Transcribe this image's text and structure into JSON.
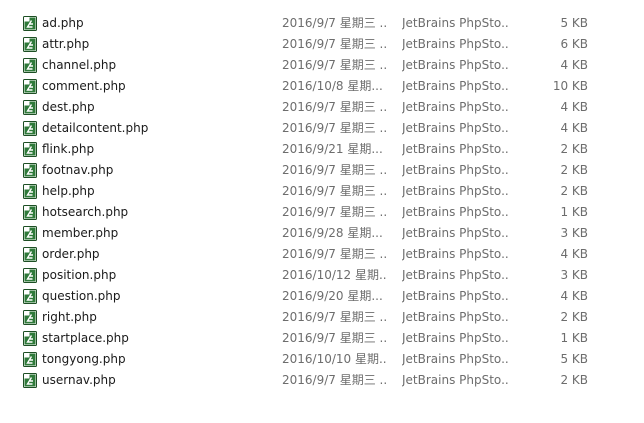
{
  "files": [
    {
      "name": "ad.php",
      "date": "2016/9/7 星期三 ...",
      "type": "JetBrains PhpSto...",
      "size": "5 KB",
      "icon": "php-file-icon"
    },
    {
      "name": "attr.php",
      "date": "2016/9/7 星期三 ...",
      "type": "JetBrains PhpSto...",
      "size": "6 KB",
      "icon": "php-file-icon"
    },
    {
      "name": "channel.php",
      "date": "2016/9/7 星期三 ...",
      "type": "JetBrains PhpSto...",
      "size": "4 KB",
      "icon": "php-file-icon"
    },
    {
      "name": "comment.php",
      "date": "2016/10/8 星期...",
      "type": "JetBrains PhpSto...",
      "size": "10 KB",
      "icon": "php-file-icon"
    },
    {
      "name": "dest.php",
      "date": "2016/9/7 星期三 ...",
      "type": "JetBrains PhpSto...",
      "size": "4 KB",
      "icon": "php-file-icon"
    },
    {
      "name": "detailcontent.php",
      "date": "2016/9/7 星期三 ...",
      "type": "JetBrains PhpSto...",
      "size": "4 KB",
      "icon": "php-file-icon"
    },
    {
      "name": "flink.php",
      "date": "2016/9/21 星期...",
      "type": "JetBrains PhpSto...",
      "size": "2 KB",
      "icon": "php-file-icon"
    },
    {
      "name": "footnav.php",
      "date": "2016/9/7 星期三 ...",
      "type": "JetBrains PhpSto...",
      "size": "2 KB",
      "icon": "php-file-icon"
    },
    {
      "name": "help.php",
      "date": "2016/9/7 星期三 ...",
      "type": "JetBrains PhpSto...",
      "size": "2 KB",
      "icon": "php-file-icon"
    },
    {
      "name": "hotsearch.php",
      "date": "2016/9/7 星期三 ...",
      "type": "JetBrains PhpSto...",
      "size": "1 KB",
      "icon": "php-file-icon"
    },
    {
      "name": "member.php",
      "date": "2016/9/28 星期...",
      "type": "JetBrains PhpSto...",
      "size": "3 KB",
      "icon": "php-file-icon"
    },
    {
      "name": "order.php",
      "date": "2016/9/7 星期三 ...",
      "type": "JetBrains PhpSto...",
      "size": "4 KB",
      "icon": "php-file-icon"
    },
    {
      "name": "position.php",
      "date": "2016/10/12 星期...",
      "type": "JetBrains PhpSto...",
      "size": "3 KB",
      "icon": "php-file-icon"
    },
    {
      "name": "question.php",
      "date": "2016/9/20 星期...",
      "type": "JetBrains PhpSto...",
      "size": "4 KB",
      "icon": "php-file-icon"
    },
    {
      "name": "right.php",
      "date": "2016/9/7 星期三 ...",
      "type": "JetBrains PhpSto...",
      "size": "2 KB",
      "icon": "php-file-icon"
    },
    {
      "name": "startplace.php",
      "date": "2016/9/7 星期三 ...",
      "type": "JetBrains PhpSto...",
      "size": "1 KB",
      "icon": "php-file-icon"
    },
    {
      "name": "tongyong.php",
      "date": "2016/10/10 星期...",
      "type": "JetBrains PhpSto...",
      "size": "5 KB",
      "icon": "php-file-icon"
    },
    {
      "name": "usernav.php",
      "date": "2016/9/7 星期三 ...",
      "type": "JetBrains PhpSto...",
      "size": "2 KB",
      "icon": "php-file-icon"
    }
  ],
  "colors": {
    "icon_background": "#2f7a3a",
    "icon_border": "#1d4f24",
    "name_text": "#1a1a1a",
    "detail_text": "#6d6d6d"
  }
}
